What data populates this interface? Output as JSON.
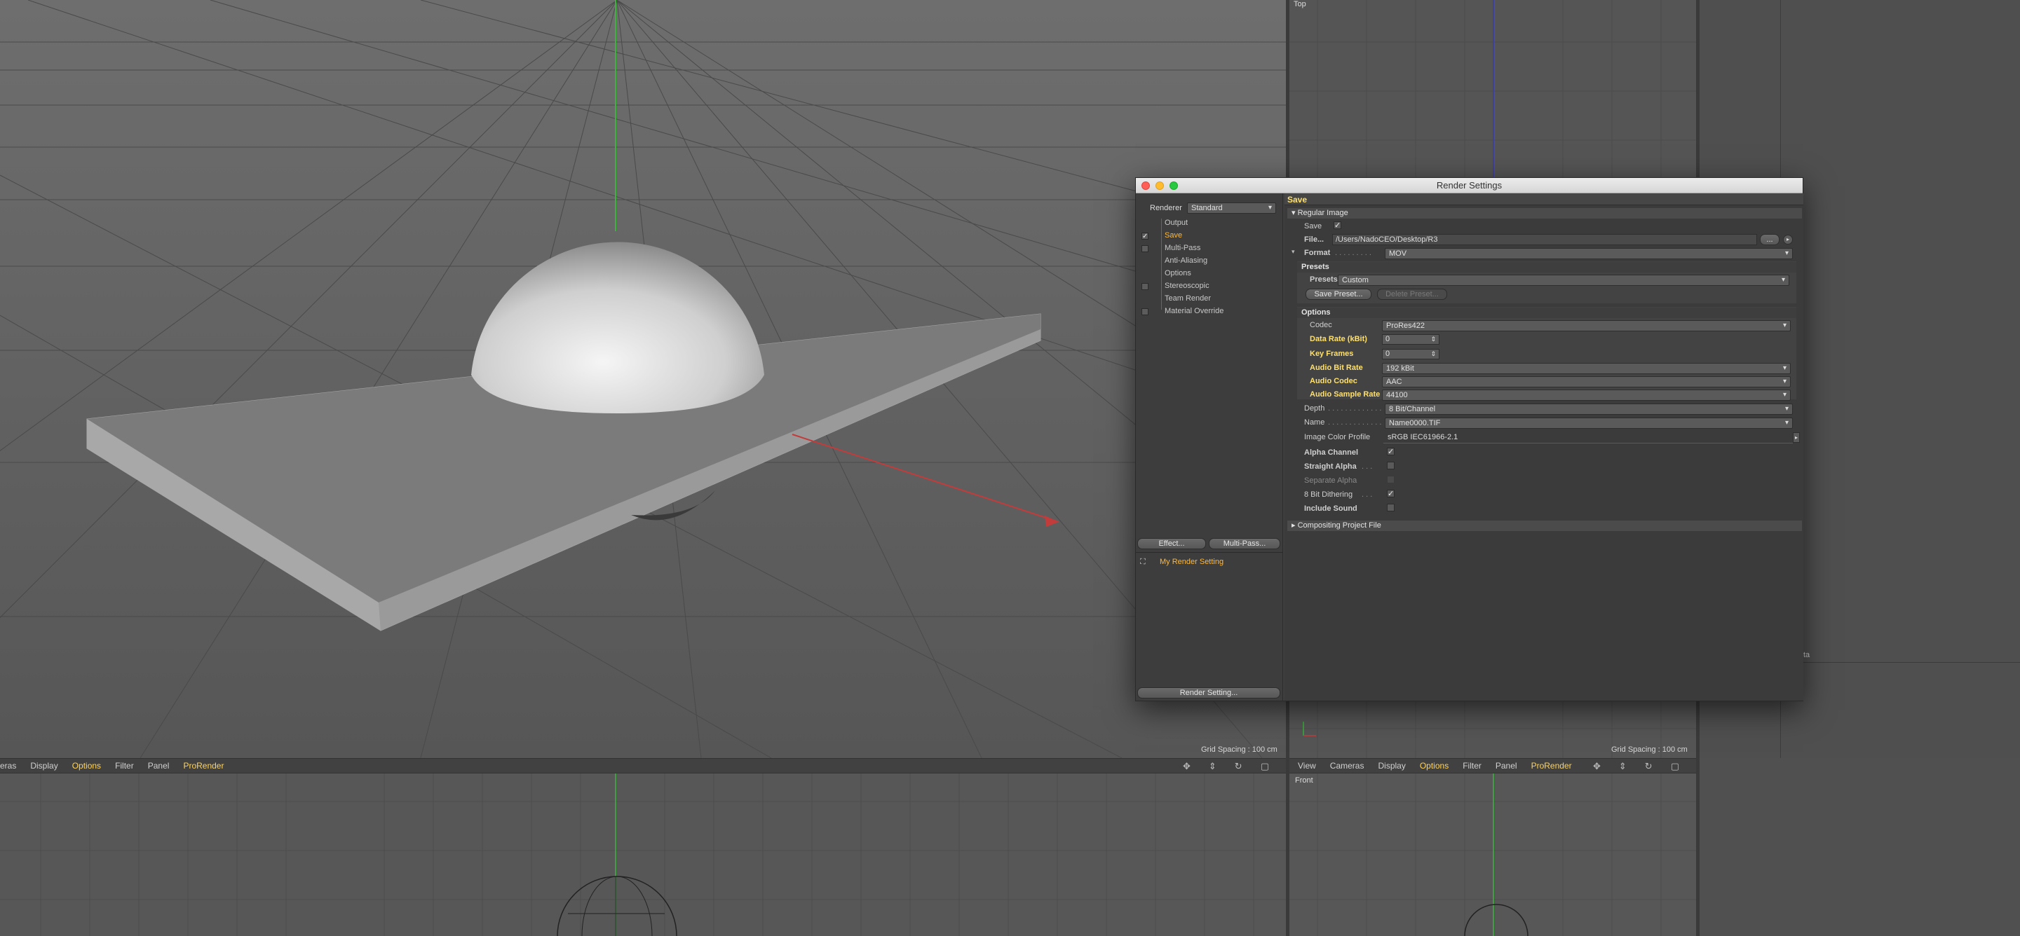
{
  "viewport_main": {
    "grid_spacing": "Grid Spacing : 100 cm"
  },
  "viewport_top": {
    "label": "Top",
    "grid_spacing": "Grid Spacing : 100 cm",
    "truncated_text": "ta"
  },
  "bottom_left_toolbar": {
    "items": [
      "eras",
      "Display",
      "Options",
      "Filter",
      "Panel",
      "ProRender"
    ]
  },
  "bottom_right_toolbar": {
    "items": [
      "View",
      "Cameras",
      "Display",
      "Options",
      "Filter",
      "Panel",
      "ProRender"
    ],
    "label": "Front"
  },
  "render_settings": {
    "title": "Render Settings",
    "renderer_label": "Renderer",
    "renderer_value": "Standard",
    "tree": [
      {
        "label": "Output",
        "checkbox": "none"
      },
      {
        "label": "Save",
        "checkbox": "checked"
      },
      {
        "label": "Multi-Pass",
        "checkbox": "unchecked"
      },
      {
        "label": "Anti-Aliasing",
        "checkbox": "none"
      },
      {
        "label": "Options",
        "checkbox": "none"
      },
      {
        "label": "Stereoscopic",
        "checkbox": "unchecked"
      },
      {
        "label": "Team Render",
        "checkbox": "none"
      },
      {
        "label": "Material Override",
        "checkbox": "unchecked"
      }
    ],
    "effect_button": "Effect...",
    "multipass_button": "Multi-Pass...",
    "setting_name": "My Render Setting",
    "render_setting_button": "Render Setting...",
    "panel_title": "Save",
    "regular_image_header": "Regular Image",
    "save_label": "Save",
    "file_label": "File...",
    "file_path": "/Users/NadoCEO/Desktop/R3",
    "file_browse_btn": "...",
    "format_label": "Format",
    "format_value": "MOV",
    "presets_header": "Presets",
    "presets_label": "Presets",
    "presets_value": "Custom",
    "save_preset_btn": "Save Preset...",
    "delete_preset_btn": "Delete Preset...",
    "options_header": "Options",
    "codec_label": "Codec",
    "codec_value": "ProRes422",
    "data_rate_label": "Data Rate (kBit)",
    "data_rate_value": "0",
    "key_frames_label": "Key Frames",
    "key_frames_value": "0",
    "audio_bit_rate_label": "Audio Bit Rate",
    "audio_bit_rate_value": "192 kBit",
    "audio_codec_label": "Audio Codec",
    "audio_codec_value": "AAC",
    "audio_sample_rate_label": "Audio Sample Rate",
    "audio_sample_rate_value": "44100",
    "depth_label": "Depth",
    "depth_value": "8 Bit/Channel",
    "name_label": "Name",
    "name_value": "Name0000.TIF",
    "color_profile_label": "Image Color Profile",
    "color_profile_value": "sRGB IEC61966-2.1",
    "alpha_channel_label": "Alpha Channel",
    "straight_alpha_label": "Straight Alpha",
    "separate_alpha_label": "Separate Alpha",
    "dithering_label": "8 Bit Dithering",
    "include_sound_label": "Include Sound",
    "compositing_header": "Compositing Project File"
  },
  "colors": {
    "accent_yellow": "#ffe06a",
    "active_orange": "#ffb83a",
    "toolbar_highlight": "#ffd35a"
  }
}
